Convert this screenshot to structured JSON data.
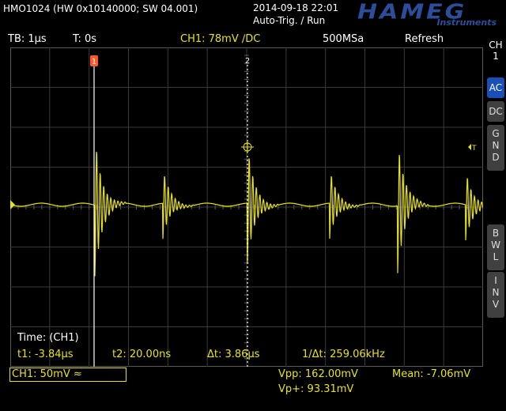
{
  "header": {
    "device": "HMO1024 (HW 0x10140000; SW 04.001)",
    "datetime": "2014-09-18 22:01",
    "trigger_mode": "Auto-Trig. / Run",
    "brand": "HAMEG",
    "brand_sub": "Instruments"
  },
  "status": {
    "timebase": "TB: 1µs",
    "trigger_time": "T: 0s",
    "channel_setting": "CH1: 78mV ∕DC",
    "sample_rate": "500MSa",
    "acq_mode": "Refresh"
  },
  "side_panel": {
    "title": "CH\n1",
    "buttons": [
      {
        "label": "AC",
        "active": true
      },
      {
        "label": "DC",
        "active": false
      },
      {
        "label": "G\nN\nD",
        "active": false
      },
      {
        "label": "B\nW\nL",
        "active": false
      },
      {
        "label": "I\nN\nV",
        "active": false
      }
    ]
  },
  "markers": {
    "cursor1": "1",
    "cursor2": "2",
    "ch_level": "1",
    "trig_level": "T"
  },
  "measurement": {
    "title": "Time: (CH1)",
    "t1": "t1: -3.84µs",
    "t2": "t2: 20.00ns",
    "dt": "Δt: 3.86µs",
    "inv_dt": "1/Δt: 259.06kHz"
  },
  "footer": {
    "ch1_scale": "CH1: 50mV ≈",
    "vpp": "Vpp: 162.00mV",
    "vp_plus": "Vp+: 93.31mV",
    "mean": "Mean: -7.06mV"
  },
  "colors": {
    "trace": "#e8e218",
    "cursor1": "#ff5a2a",
    "grid": "#5a5a5a",
    "brand": "#2c4e9a",
    "active_btn": "#1a4fb5"
  }
}
